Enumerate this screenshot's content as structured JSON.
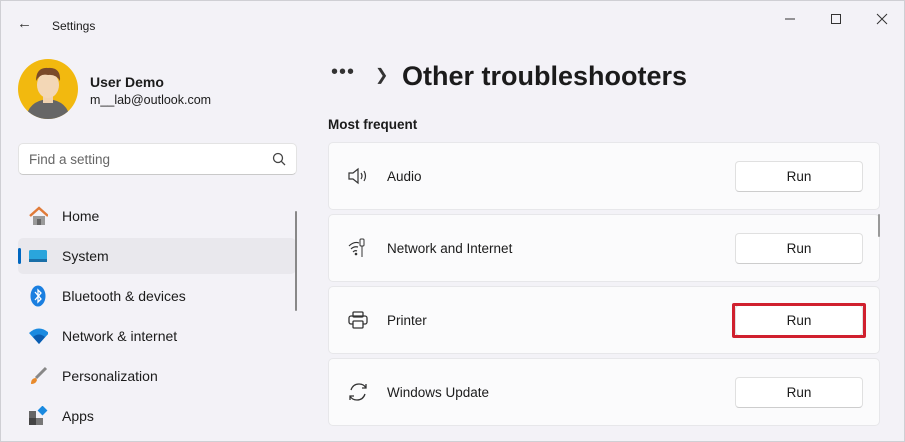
{
  "window": {
    "title": "Settings",
    "back_icon": "arrow-left-icon",
    "controls": [
      "minimize",
      "maximize",
      "close"
    ]
  },
  "user": {
    "name": "User Demo",
    "email": "m__lab@outlook.com"
  },
  "search": {
    "placeholder": "Find a setting"
  },
  "sidebar": {
    "items": [
      {
        "label": "Home",
        "icon": "home-icon"
      },
      {
        "label": "System",
        "icon": "system-icon",
        "selected": true
      },
      {
        "label": "Bluetooth & devices",
        "icon": "bluetooth-icon"
      },
      {
        "label": "Network & internet",
        "icon": "wifi-icon"
      },
      {
        "label": "Personalization",
        "icon": "brush-icon"
      },
      {
        "label": "Apps",
        "icon": "apps-icon"
      }
    ]
  },
  "header": {
    "breadcrumb_more": "•••",
    "title": "Other troubleshooters"
  },
  "main": {
    "section": "Most frequent",
    "items": [
      {
        "label": "Audio",
        "button": "Run",
        "icon": "speaker-icon"
      },
      {
        "label": "Network and Internet",
        "button": "Run",
        "icon": "network-icon"
      },
      {
        "label": "Printer",
        "button": "Run",
        "icon": "printer-icon",
        "highlighted": true
      },
      {
        "label": "Windows Update",
        "button": "Run",
        "icon": "sync-icon"
      }
    ]
  },
  "colors": {
    "accent": "#0067c0",
    "highlight": "#d0202e"
  }
}
